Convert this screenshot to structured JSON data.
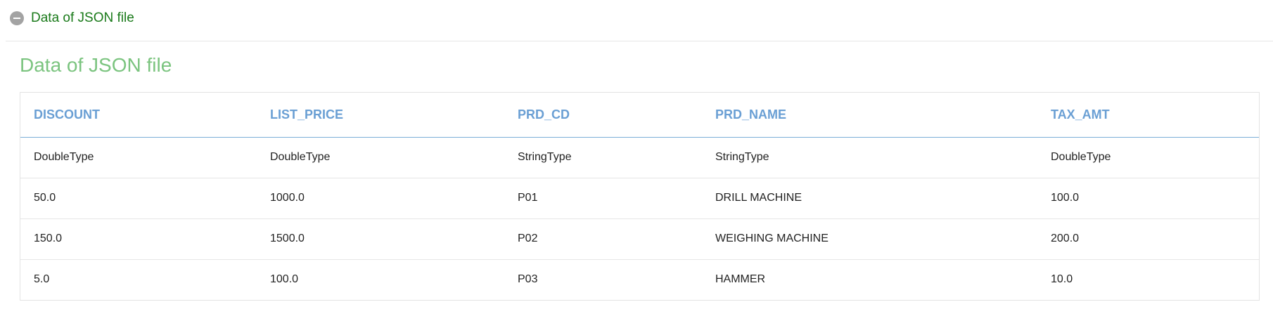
{
  "panel": {
    "toggle_label": "Data of JSON file"
  },
  "section": {
    "title": "Data of JSON file"
  },
  "table": {
    "headers": [
      "DISCOUNT",
      "LIST_PRICE",
      "PRD_CD",
      "PRD_NAME",
      "TAX_AMT"
    ],
    "types": [
      "DoubleType",
      "DoubleType",
      "StringType",
      "StringType",
      "DoubleType"
    ],
    "rows": [
      [
        "50.0",
        "1000.0",
        "P01",
        "DRILL MACHINE",
        "100.0"
      ],
      [
        "150.0",
        "1500.0",
        "P02",
        "WEIGHING MACHINE",
        "200.0"
      ],
      [
        "5.0",
        "100.0",
        "P03",
        "HAMMER",
        "10.0"
      ]
    ]
  },
  "colors": {
    "toggle_text": "#1a7a1a",
    "title_text": "#7bc47f",
    "header_text": "#6a9fd4",
    "header_rule": "#7aaed8",
    "icon_bg": "#a3a3a3"
  },
  "icons": {
    "collapse": "minus-circle-icon"
  }
}
